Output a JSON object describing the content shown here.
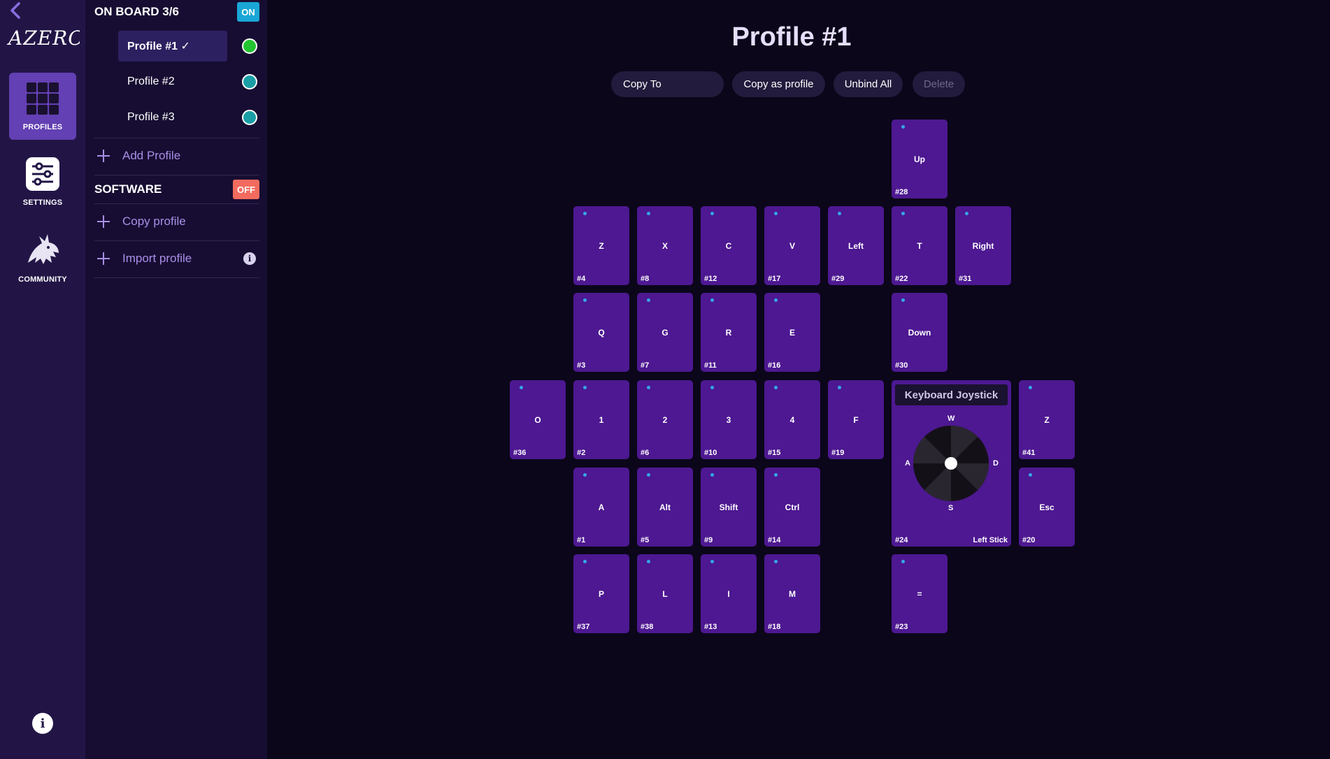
{
  "rail": {
    "logo_text": "AZERON",
    "items": [
      {
        "label": "PROFILES",
        "icon": "grid-icon"
      },
      {
        "label": "SETTINGS",
        "icon": "sliders-icon"
      },
      {
        "label": "COMMUNITY",
        "icon": "dragon-icon"
      }
    ],
    "info_symbol": "i"
  },
  "panel": {
    "onboard_title": "ON BOARD 3/6",
    "onboard_toggle": "ON",
    "profiles": [
      {
        "name": "Profile #1 ✓",
        "status_color": "#22c431"
      },
      {
        "name": "Profile #2",
        "status_color": "#1a9ea6"
      },
      {
        "name": "Profile #3",
        "status_color": "#1a9ea6"
      }
    ],
    "add_profile": "Add Profile",
    "software_title": "SOFTWARE",
    "software_toggle": "OFF",
    "copy_profile": "Copy profile",
    "import_profile": "Import profile",
    "info_symbol": "i"
  },
  "main": {
    "title": "Profile #1",
    "toolbar": {
      "copy_to": "Copy To",
      "copy_as_profile": "Copy as profile",
      "unbind_all": "Unbind All",
      "delete": "Delete"
    },
    "keys": [
      {
        "label": "Up",
        "num": "#28"
      },
      {
        "label": "Z",
        "num": "#4"
      },
      {
        "label": "X",
        "num": "#8"
      },
      {
        "label": "C",
        "num": "#12"
      },
      {
        "label": "V",
        "num": "#17"
      },
      {
        "label": "Left",
        "num": "#29"
      },
      {
        "label": "T",
        "num": "#22"
      },
      {
        "label": "Right",
        "num": "#31"
      },
      {
        "label": "Q",
        "num": "#3"
      },
      {
        "label": "G",
        "num": "#7"
      },
      {
        "label": "R",
        "num": "#11"
      },
      {
        "label": "E",
        "num": "#16"
      },
      {
        "label": "Down",
        "num": "#30"
      },
      {
        "label": "O",
        "num": "#36"
      },
      {
        "label": "1",
        "num": "#2"
      },
      {
        "label": "2",
        "num": "#6"
      },
      {
        "label": "3",
        "num": "#10"
      },
      {
        "label": "4",
        "num": "#15"
      },
      {
        "label": "F",
        "num": "#19"
      },
      {
        "label": "Z",
        "num": "#41"
      },
      {
        "label": "A",
        "num": "#1"
      },
      {
        "label": "Alt",
        "num": "#5"
      },
      {
        "label": "Shift",
        "num": "#9"
      },
      {
        "label": "Ctrl",
        "num": "#14"
      },
      {
        "label": "Esc",
        "num": "#20"
      },
      {
        "label": "P",
        "num": "#37"
      },
      {
        "label": "L",
        "num": "#38"
      },
      {
        "label": "I",
        "num": "#13"
      },
      {
        "label": "M",
        "num": "#18"
      },
      {
        "label": "=",
        "num": "#23"
      }
    ],
    "joystick": {
      "title": "Keyboard Joystick",
      "up": "W",
      "left": "A",
      "right": "D",
      "down": "S",
      "num": "#24",
      "sub": "Left Stick"
    }
  },
  "colors": {
    "rail_bg": "#221546",
    "panel_bg": "#170d32",
    "main_bg": "#0b061a",
    "key_bg": "#4d1891",
    "accent_active": "#6340b3",
    "toggle_on": "#1aa7d6",
    "toggle_off": "#f26b5e"
  }
}
